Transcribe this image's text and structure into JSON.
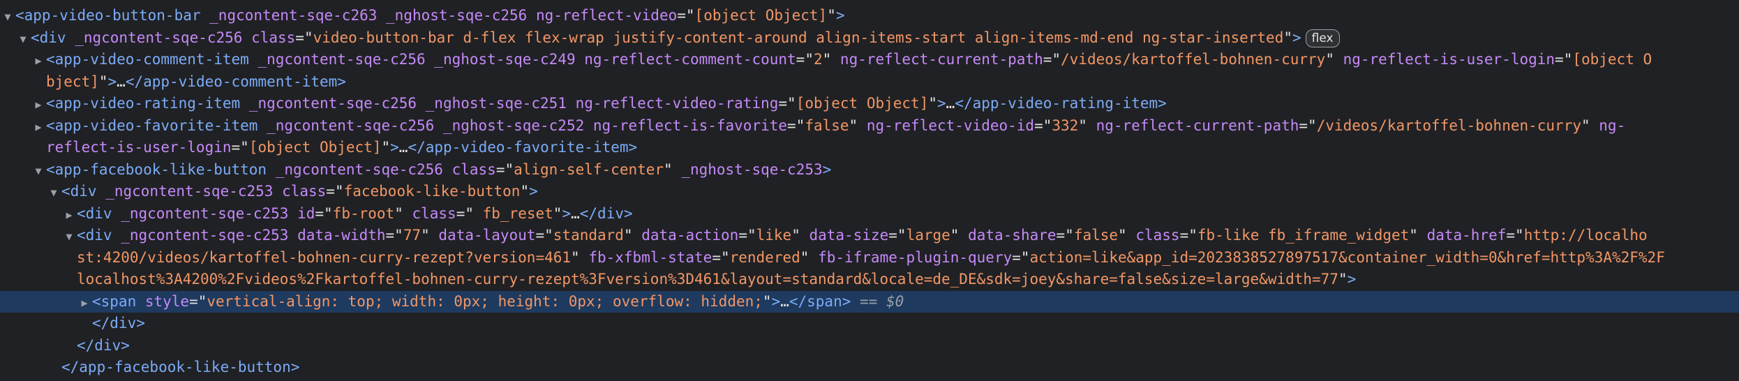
{
  "lines": [
    {
      "indent": 22,
      "toggle": "down",
      "segments": [
        {
          "t": "tag",
          "v": "<app-video-button-bar "
        },
        {
          "t": "an",
          "v": "_ngcontent-sqe-c263 _nghost-sqe-c256 ng-reflect-video"
        },
        {
          "t": "pn",
          "v": "=\""
        },
        {
          "t": "av",
          "v": "[object Object]"
        },
        {
          "t": "pn",
          "v": "\""
        },
        {
          "t": "tag",
          "v": ">"
        }
      ]
    },
    {
      "indent": 44,
      "toggle": "down",
      "segments": [
        {
          "t": "tag",
          "v": "<div "
        },
        {
          "t": "an",
          "v": "_ngcontent-sqe-c256 class"
        },
        {
          "t": "pn",
          "v": "=\""
        },
        {
          "t": "av",
          "v": "video-button-bar d-flex flex-wrap justify-content-around align-items-start align-items-md-end ng-star-inserted"
        },
        {
          "t": "pn",
          "v": "\""
        },
        {
          "t": "tag",
          "v": ">"
        }
      ],
      "badge": "flex"
    },
    {
      "indent": 66,
      "toggle": "right",
      "segments": [
        {
          "t": "tag",
          "v": "<app-video-comment-item "
        },
        {
          "t": "an",
          "v": "_ngcontent-sqe-c256 _nghost-sqe-c249 ng-reflect-comment-count"
        },
        {
          "t": "pn",
          "v": "=\""
        },
        {
          "t": "av",
          "v": "2"
        },
        {
          "t": "pn",
          "v": "\" "
        },
        {
          "t": "an",
          "v": "ng-reflect-current-path"
        },
        {
          "t": "pn",
          "v": "=\""
        },
        {
          "t": "av",
          "v": "/videos/kartoffel-bohnen-curry"
        },
        {
          "t": "pn",
          "v": "\" "
        },
        {
          "t": "an",
          "v": "ng-reflect-is-user-login"
        },
        {
          "t": "pn",
          "v": "=\""
        },
        {
          "t": "av",
          "v": "[object O"
        }
      ]
    },
    {
      "indent": 66,
      "toggle": "none",
      "segments": [
        {
          "t": "av",
          "v": "bject]"
        },
        {
          "t": "pn",
          "v": "\""
        },
        {
          "t": "tag",
          "v": ">"
        },
        {
          "t": "pn",
          "v": "…"
        },
        {
          "t": "tag",
          "v": "</app-video-comment-item>"
        }
      ]
    },
    {
      "indent": 66,
      "toggle": "right",
      "segments": [
        {
          "t": "tag",
          "v": "<app-video-rating-item "
        },
        {
          "t": "an",
          "v": "_ngcontent-sqe-c256 _nghost-sqe-c251 ng-reflect-video-rating"
        },
        {
          "t": "pn",
          "v": "=\""
        },
        {
          "t": "av",
          "v": "[object Object]"
        },
        {
          "t": "pn",
          "v": "\""
        },
        {
          "t": "tag",
          "v": ">"
        },
        {
          "t": "pn",
          "v": "…"
        },
        {
          "t": "tag",
          "v": "</app-video-rating-item>"
        }
      ]
    },
    {
      "indent": 66,
      "toggle": "right",
      "segments": [
        {
          "t": "tag",
          "v": "<app-video-favorite-item "
        },
        {
          "t": "an",
          "v": "_ngcontent-sqe-c256 _nghost-sqe-c252 ng-reflect-is-favorite"
        },
        {
          "t": "pn",
          "v": "=\""
        },
        {
          "t": "av",
          "v": "false"
        },
        {
          "t": "pn",
          "v": "\" "
        },
        {
          "t": "an",
          "v": "ng-reflect-video-id"
        },
        {
          "t": "pn",
          "v": "=\""
        },
        {
          "t": "av",
          "v": "332"
        },
        {
          "t": "pn",
          "v": "\" "
        },
        {
          "t": "an",
          "v": "ng-reflect-current-path"
        },
        {
          "t": "pn",
          "v": "=\""
        },
        {
          "t": "av",
          "v": "/videos/kartoffel-bohnen-curry"
        },
        {
          "t": "pn",
          "v": "\" "
        },
        {
          "t": "an",
          "v": "ng-"
        }
      ]
    },
    {
      "indent": 66,
      "toggle": "none",
      "segments": [
        {
          "t": "an",
          "v": "reflect-is-user-login"
        },
        {
          "t": "pn",
          "v": "=\""
        },
        {
          "t": "av",
          "v": "[object Object]"
        },
        {
          "t": "pn",
          "v": "\""
        },
        {
          "t": "tag",
          "v": ">"
        },
        {
          "t": "pn",
          "v": "…"
        },
        {
          "t": "tag",
          "v": "</app-video-favorite-item>"
        }
      ]
    },
    {
      "indent": 66,
      "toggle": "down",
      "segments": [
        {
          "t": "tag",
          "v": "<app-facebook-like-button "
        },
        {
          "t": "an",
          "v": "_ngcontent-sqe-c256 class"
        },
        {
          "t": "pn",
          "v": "=\""
        },
        {
          "t": "av",
          "v": "align-self-center"
        },
        {
          "t": "pn",
          "v": "\" "
        },
        {
          "t": "an",
          "v": "_nghost-sqe-c253"
        },
        {
          "t": "tag",
          "v": ">"
        }
      ]
    },
    {
      "indent": 88,
      "toggle": "down",
      "segments": [
        {
          "t": "tag",
          "v": "<div "
        },
        {
          "t": "an",
          "v": "_ngcontent-sqe-c253 class"
        },
        {
          "t": "pn",
          "v": "=\""
        },
        {
          "t": "av",
          "v": "facebook-like-button"
        },
        {
          "t": "pn",
          "v": "\""
        },
        {
          "t": "tag",
          "v": ">"
        }
      ]
    },
    {
      "indent": 110,
      "toggle": "right",
      "segments": [
        {
          "t": "tag",
          "v": "<div "
        },
        {
          "t": "an",
          "v": "_ngcontent-sqe-c253 id"
        },
        {
          "t": "pn",
          "v": "=\""
        },
        {
          "t": "av",
          "v": "fb-root"
        },
        {
          "t": "pn",
          "v": "\" "
        },
        {
          "t": "an",
          "v": "class"
        },
        {
          "t": "pn",
          "v": "=\""
        },
        {
          "t": "av",
          "v": " fb_reset"
        },
        {
          "t": "pn",
          "v": "\""
        },
        {
          "t": "tag",
          "v": ">"
        },
        {
          "t": "pn",
          "v": "…"
        },
        {
          "t": "tag",
          "v": "</div>"
        }
      ]
    },
    {
      "indent": 110,
      "toggle": "down",
      "segments": [
        {
          "t": "tag",
          "v": "<div "
        },
        {
          "t": "an",
          "v": "_ngcontent-sqe-c253 data-width"
        },
        {
          "t": "pn",
          "v": "=\""
        },
        {
          "t": "av",
          "v": "77"
        },
        {
          "t": "pn",
          "v": "\" "
        },
        {
          "t": "an",
          "v": "data-layout"
        },
        {
          "t": "pn",
          "v": "=\""
        },
        {
          "t": "av",
          "v": "standard"
        },
        {
          "t": "pn",
          "v": "\" "
        },
        {
          "t": "an",
          "v": "data-action"
        },
        {
          "t": "pn",
          "v": "=\""
        },
        {
          "t": "av",
          "v": "like"
        },
        {
          "t": "pn",
          "v": "\" "
        },
        {
          "t": "an",
          "v": "data-size"
        },
        {
          "t": "pn",
          "v": "=\""
        },
        {
          "t": "av",
          "v": "large"
        },
        {
          "t": "pn",
          "v": "\" "
        },
        {
          "t": "an",
          "v": "data-share"
        },
        {
          "t": "pn",
          "v": "=\""
        },
        {
          "t": "av",
          "v": "false"
        },
        {
          "t": "pn",
          "v": "\" "
        },
        {
          "t": "an",
          "v": "class"
        },
        {
          "t": "pn",
          "v": "=\""
        },
        {
          "t": "av",
          "v": "fb-like fb_iframe_widget"
        },
        {
          "t": "pn",
          "v": "\" "
        },
        {
          "t": "an",
          "v": "data-href"
        },
        {
          "t": "pn",
          "v": "=\""
        },
        {
          "t": "av",
          "v": "http://localho"
        }
      ]
    },
    {
      "indent": 110,
      "toggle": "none",
      "segments": [
        {
          "t": "av",
          "v": "st:4200/videos/kartoffel-bohnen-curry-rezept?version=461"
        },
        {
          "t": "pn",
          "v": "\" "
        },
        {
          "t": "an",
          "v": "fb-xfbml-state"
        },
        {
          "t": "pn",
          "v": "=\""
        },
        {
          "t": "av",
          "v": "rendered"
        },
        {
          "t": "pn",
          "v": "\" "
        },
        {
          "t": "an",
          "v": "fb-iframe-plugin-query"
        },
        {
          "t": "pn",
          "v": "=\""
        },
        {
          "t": "av",
          "v": "action=like&app_id=2023838527897517&container_width=0&href=http%3A%2F%2F"
        }
      ]
    },
    {
      "indent": 110,
      "toggle": "none",
      "segments": [
        {
          "t": "av",
          "v": "localhost%3A4200%2Fvideos%2Fkartoffel-bohnen-curry-rezept%3Fversion%3D461&layout=standard&locale=de_DE&sdk=joey&share=false&size=large&width=77"
        },
        {
          "t": "pn",
          "v": "\""
        },
        {
          "t": "tag",
          "v": ">"
        }
      ]
    },
    {
      "indent": 132,
      "toggle": "right",
      "selected": true,
      "segments": [
        {
          "t": "tag",
          "v": "<span "
        },
        {
          "t": "an",
          "v": "style"
        },
        {
          "t": "pn",
          "v": "=\""
        },
        {
          "t": "av",
          "v": "vertical-align: top; width: 0px; height: 0px; overflow: hidden;"
        },
        {
          "t": "pn",
          "v": "\""
        },
        {
          "t": "tag",
          "v": ">"
        },
        {
          "t": "pn",
          "v": "…"
        },
        {
          "t": "tag",
          "v": "</span>"
        },
        {
          "t": "dim",
          "v": " == $0"
        }
      ]
    },
    {
      "indent": 132,
      "toggle": "none",
      "segments": [
        {
          "t": "tag",
          "v": "</div>"
        }
      ]
    },
    {
      "indent": 110,
      "toggle": "none",
      "segments": [
        {
          "t": "tag",
          "v": "</div>"
        }
      ]
    },
    {
      "indent": 88,
      "toggle": "none",
      "segments": [
        {
          "t": "tag",
          "v": "</app-facebook-like-button>"
        }
      ]
    }
  ]
}
